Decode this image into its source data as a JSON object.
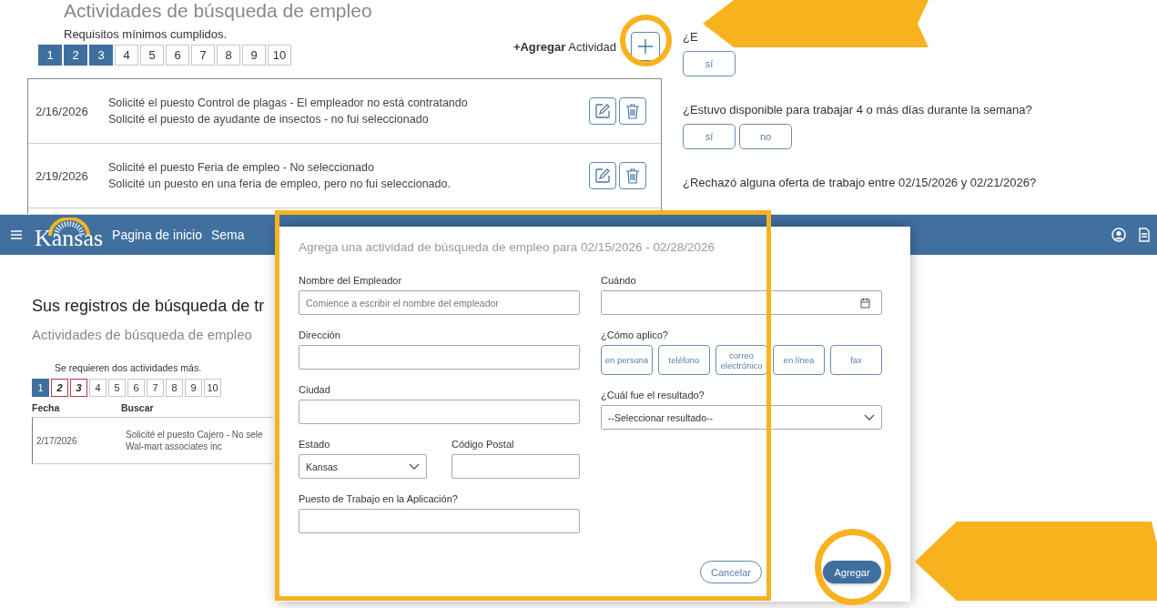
{
  "top_screen": {
    "heading": "Actividades de búsqueda de empleo",
    "status": "Requisitos mínimos cumplidos.",
    "add_label": "**+Agregar** Actividad",
    "pages": [
      {
        "label": "1",
        "done": true
      },
      {
        "label": "2",
        "done": true
      },
      {
        "label": "3",
        "done": true
      },
      {
        "label": "4",
        "done": false
      },
      {
        "label": "5",
        "done": false
      },
      {
        "label": "6",
        "done": false
      },
      {
        "label": "7",
        "done": false
      },
      {
        "label": "8",
        "done": false
      },
      {
        "label": "9",
        "done": false
      },
      {
        "label": "10",
        "done": false
      }
    ],
    "activities": [
      {
        "date": "2/16/2026",
        "lines": [
          "Solicité el puesto Control de plagas - El empleador no está contratando",
          "Solicité el puesto de ayudante de insectos - no fui seleccionado"
        ]
      },
      {
        "date": "2/19/2026",
        "lines": [
          "Solicité el puesto Feria de empleo - No seleccionado",
          "Solicité un puesto en una feria de empleo, pero no fui seleccionado."
        ]
      }
    ],
    "questions": [
      {
        "text": "¿E",
        "answers": [
          {
            "label": "sí",
            "selected": false
          }
        ]
      },
      {
        "text": "¿Estuvo disponible para trabajar 4 o más días durante la semana?",
        "answers": [
          {
            "label": "sí",
            "selected": false
          },
          {
            "label": "no",
            "selected": false
          }
        ]
      },
      {
        "text": "¿Rechazó alguna oferta de trabajo entre 02/15/2026 y 02/21/2026?"
      }
    ]
  },
  "nav": {
    "logo": "Kansas",
    "links": [
      "Pagina de inicio",
      "Sema"
    ]
  },
  "page": {
    "title": "Sus registros de búsqueda de tr",
    "subtitle": "Actividades de búsqueda de empleo",
    "status": "Se requieren dos actividades más.",
    "pages": [
      {
        "label": "1",
        "done": true,
        "missing": false
      },
      {
        "label": "2",
        "done": false,
        "missing": true
      },
      {
        "label": "3",
        "done": false,
        "missing": true
      },
      {
        "label": "4",
        "done": false,
        "missing": false
      },
      {
        "label": "5",
        "done": false,
        "missing": false
      },
      {
        "label": "6",
        "done": false,
        "missing": false
      },
      {
        "label": "7",
        "done": false,
        "missing": false
      },
      {
        "label": "8",
        "done": false,
        "missing": false
      },
      {
        "label": "9",
        "done": false,
        "missing": false
      },
      {
        "label": "10",
        "done": false,
        "missing": false
      }
    ],
    "columns": [
      "Fecha",
      "Buscar"
    ],
    "rows": [
      {
        "date": "2/17/2026",
        "lines": [
          "Solicité el puesto Cajero - No sele",
          "Wal-mart associates inc"
        ]
      }
    ]
  },
  "modal": {
    "title": "Agrega una actividad de búsqueda de empleo para 02/15/2026 - 02/28/2026",
    "left_rows": [
      [
        {
          "label": "Nombre del Empleador",
          "kind": "text",
          "placeholder": "Comience a escribir el nombre del empleador"
        }
      ],
      [
        {
          "label": "Dirección",
          "kind": "text"
        }
      ],
      [
        {
          "label": "Ciudad",
          "kind": "text"
        }
      ],
      [
        {
          "label": "Estado",
          "kind": "select",
          "value": "Kansas"
        },
        {
          "label": "Código Postal",
          "kind": "text"
        }
      ],
      [
        {
          "label": "Puesto de Trabajo en la Aplicación?",
          "kind": "text"
        }
      ]
    ],
    "when": {
      "label": "Cuándo"
    },
    "method": {
      "label": "¿Cómo aplico?",
      "options": [
        {
          "label": "en persona",
          "selected": false
        },
        {
          "label": "teléfono",
          "selected": false
        },
        {
          "label": "correo electrónico",
          "selected": false
        },
        {
          "label": "en línea",
          "selected": false
        },
        {
          "label": "fax",
          "selected": false
        }
      ]
    },
    "result": {
      "label": "¿Cuál fue el resultado?",
      "value": "--Seleccionar resultado--"
    },
    "cancel": "Cancelar",
    "submit": "Agregar"
  }
}
